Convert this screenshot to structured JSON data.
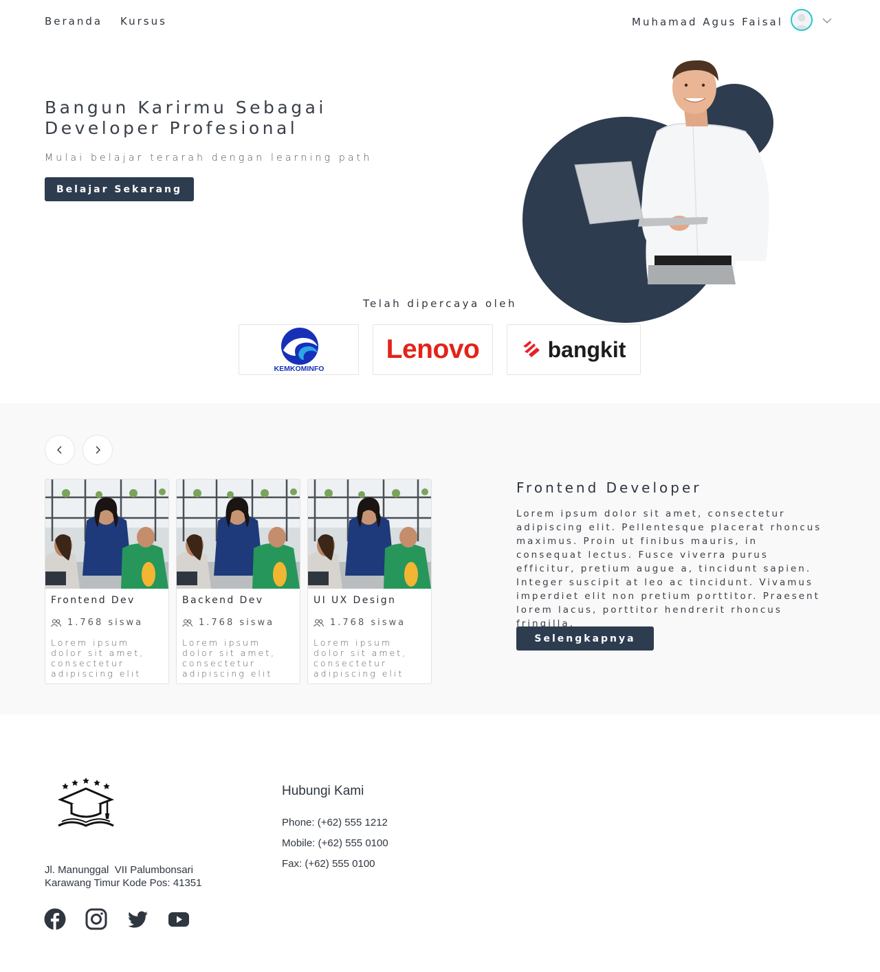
{
  "nav": {
    "home": "Beranda",
    "courses": "Kursus",
    "user_name": "Muhamad Agus Faisal"
  },
  "hero": {
    "title": "Bangun Karirmu Sebagai Developer Profesional",
    "subtitle": "Mulai belajar terarah dengan learning path",
    "cta": "Belajar Sekarang"
  },
  "trusted": {
    "label": "Telah dipercaya oleh",
    "logos": [
      "KEMKOMINFO",
      "Lenovo",
      "bangkit"
    ]
  },
  "courses": {
    "cards": [
      {
        "title": "Frontend Dev",
        "students": "1.768 siswa",
        "desc": "Lorem ipsum dolor sit amet, consectetur adipiscing elit"
      },
      {
        "title": "Backend Dev",
        "students": "1.768 siswa",
        "desc": "Lorem ipsum dolor sit amet, consectetur adipiscing elit"
      },
      {
        "title": "UI UX Design",
        "students": "1.768 siswa",
        "desc": "Lorem ipsum dolor sit amet, consectetur adipiscing elit"
      }
    ],
    "detail": {
      "title": "Frontend Developer",
      "desc": "Lorem ipsum dolor sit amet, consectetur adipiscing elit. Pellentesque placerat rhoncus maximus. Proin ut finibus mauris, in consequat lectus. Fusce viverra purus efficitur, pretium augue a, tincidunt sapien. Integer suscipit at leo ac tincidunt. Vivamus imperdiet elit non pretium porttitor. Praesent lorem lacus, porttitor hendrerit rhoncus fringilla,",
      "cta": "Selengkapnya"
    }
  },
  "footer": {
    "address_line1": "Jl. Manunggal  VII Palumbonsari",
    "address_line2": "Karawang Timur Kode Pos: 41351",
    "contact_title": "Hubungi Kami",
    "phone": "Phone: (+62) 555 1212",
    "mobile": "Mobile: (+62) 555 0100",
    "fax": "Fax: (+62) 555 0100",
    "social": [
      "facebook-icon",
      "instagram-icon",
      "twitter-icon",
      "youtube-icon"
    ]
  },
  "colors": {
    "primary": "#2d3c4f",
    "accent": "#27c6d0",
    "section_bg": "#f9f9f9"
  }
}
